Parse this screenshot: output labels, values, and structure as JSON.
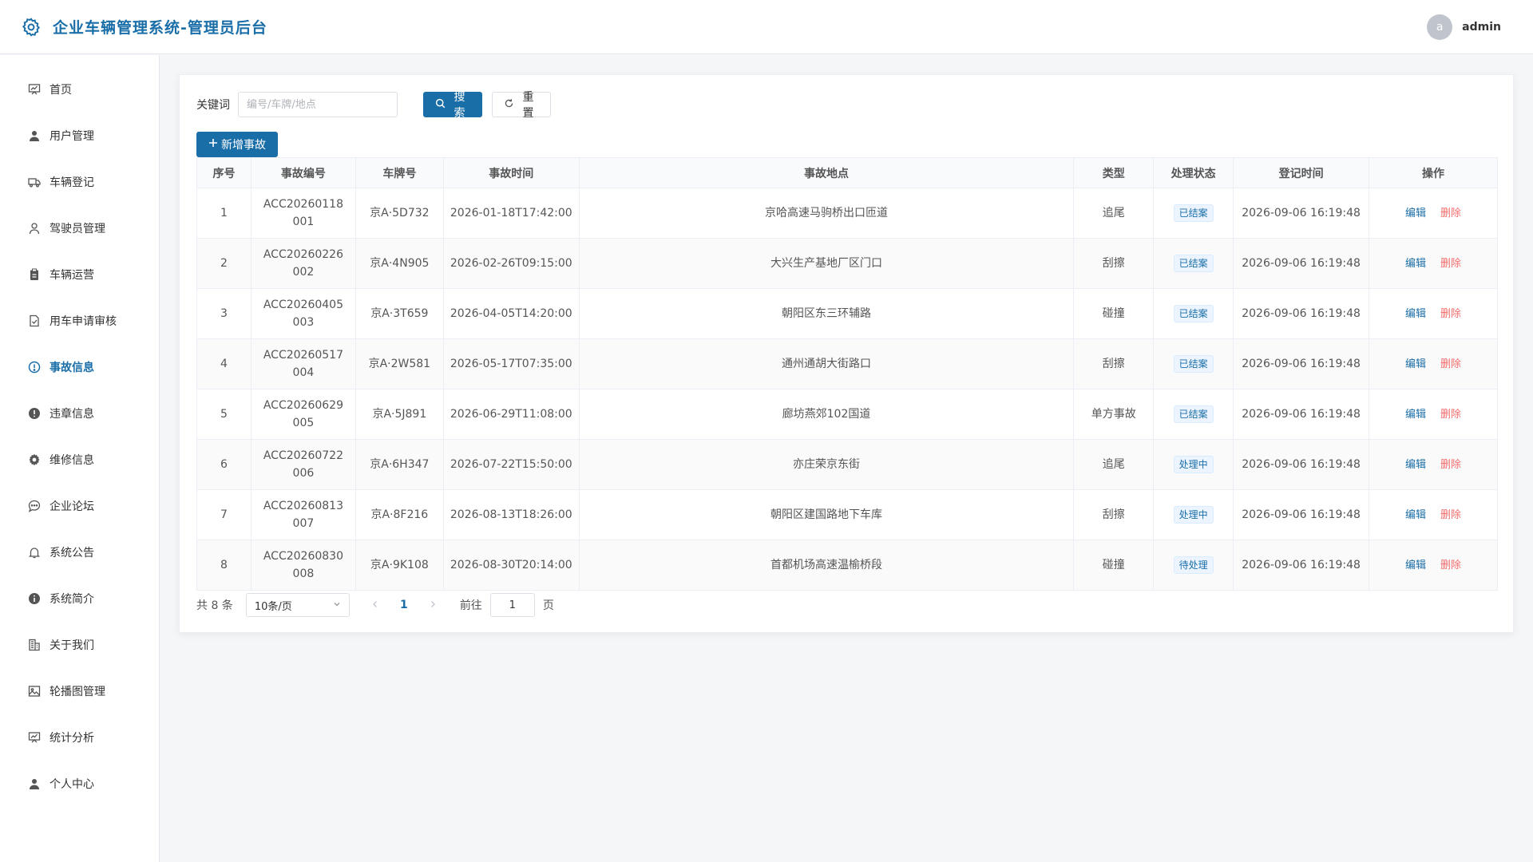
{
  "app": {
    "title": "企业车辆管理系统-管理员后台",
    "user": {
      "avatar_letter": "a",
      "name": "admin"
    },
    "accent_color": "#1a6ea8"
  },
  "sidebar": {
    "items": [
      {
        "label": "首页",
        "icon": "chart-board-icon",
        "active": false
      },
      {
        "label": "用户管理",
        "icon": "user-icon",
        "active": false
      },
      {
        "label": "车辆登记",
        "icon": "truck-icon",
        "active": false
      },
      {
        "label": "驾驶员管理",
        "icon": "user-outline-icon",
        "active": false
      },
      {
        "label": "车辆运营",
        "icon": "clipboard-icon",
        "active": false
      },
      {
        "label": "用车申请审核",
        "icon": "document-check-icon",
        "active": false
      },
      {
        "label": "事故信息",
        "icon": "warning-circle-icon",
        "active": true
      },
      {
        "label": "违章信息",
        "icon": "warning-filled-icon",
        "active": false
      },
      {
        "label": "维修信息",
        "icon": "gear-icon",
        "active": false
      },
      {
        "label": "企业论坛",
        "icon": "chat-icon",
        "active": false
      },
      {
        "label": "系统公告",
        "icon": "bell-icon",
        "active": false
      },
      {
        "label": "系统简介",
        "icon": "info-icon",
        "active": false
      },
      {
        "label": "关于我们",
        "icon": "building-icon",
        "active": false
      },
      {
        "label": "轮播图管理",
        "icon": "picture-icon",
        "active": false
      },
      {
        "label": "统计分析",
        "icon": "chart-board-icon",
        "active": false
      },
      {
        "label": "个人中心",
        "icon": "user-icon",
        "active": false
      }
    ]
  },
  "search": {
    "label": "关键词",
    "placeholder": "编号/车牌/地点",
    "value": "",
    "search_button": "搜索",
    "reset_button": "重置",
    "add_button": "新增事故"
  },
  "table": {
    "columns": [
      "序号",
      "事故编号",
      "车牌号",
      "事故时间",
      "事故地点",
      "类型",
      "处理状态",
      "登记时间",
      "操作"
    ],
    "edit_label": "编辑",
    "delete_label": "删除",
    "rows": [
      {
        "no": "1",
        "code": "ACC20260118001",
        "plate": "京A·5D732",
        "time": "2026-01-18T17:42:00",
        "place": "京哈高速马驹桥出口匝道",
        "type": "追尾",
        "status": "已结案",
        "reg_time": "2026-09-06 16:19:48"
      },
      {
        "no": "2",
        "code": "ACC20260226002",
        "plate": "京A·4N905",
        "time": "2026-02-26T09:15:00",
        "place": "大兴生产基地厂区门口",
        "type": "刮擦",
        "status": "已结案",
        "reg_time": "2026-09-06 16:19:48"
      },
      {
        "no": "3",
        "code": "ACC20260405003",
        "plate": "京A·3T659",
        "time": "2026-04-05T14:20:00",
        "place": "朝阳区东三环辅路",
        "type": "碰撞",
        "status": "已结案",
        "reg_time": "2026-09-06 16:19:48"
      },
      {
        "no": "4",
        "code": "ACC20260517004",
        "plate": "京A·2W581",
        "time": "2026-05-17T07:35:00",
        "place": "通州通胡大街路口",
        "type": "刮擦",
        "status": "已结案",
        "reg_time": "2026-09-06 16:19:48"
      },
      {
        "no": "5",
        "code": "ACC20260629005",
        "plate": "京A·5J891",
        "time": "2026-06-29T11:08:00",
        "place": "廊坊燕郊102国道",
        "type": "单方事故",
        "status": "已结案",
        "reg_time": "2026-09-06 16:19:48"
      },
      {
        "no": "6",
        "code": "ACC20260722006",
        "plate": "京A·6H347",
        "time": "2026-07-22T15:50:00",
        "place": "亦庄荣京东街",
        "type": "追尾",
        "status": "处理中",
        "reg_time": "2026-09-06 16:19:48"
      },
      {
        "no": "7",
        "code": "ACC20260813007",
        "plate": "京A·8F216",
        "time": "2026-08-13T18:26:00",
        "place": "朝阳区建国路地下车库",
        "type": "刮擦",
        "status": "处理中",
        "reg_time": "2026-09-06 16:19:48"
      },
      {
        "no": "8",
        "code": "ACC20260830008",
        "plate": "京A·9K108",
        "time": "2026-08-30T20:14:00",
        "place": "首都机场高速温榆桥段",
        "type": "碰撞",
        "status": "待处理",
        "reg_time": "2026-09-06 16:19:48"
      }
    ]
  },
  "pagination": {
    "total_text": "共 8 条",
    "page_size": "10条/页",
    "current_page": "1",
    "goto_label": "前往",
    "goto_value": "1",
    "page_suffix": "页"
  }
}
